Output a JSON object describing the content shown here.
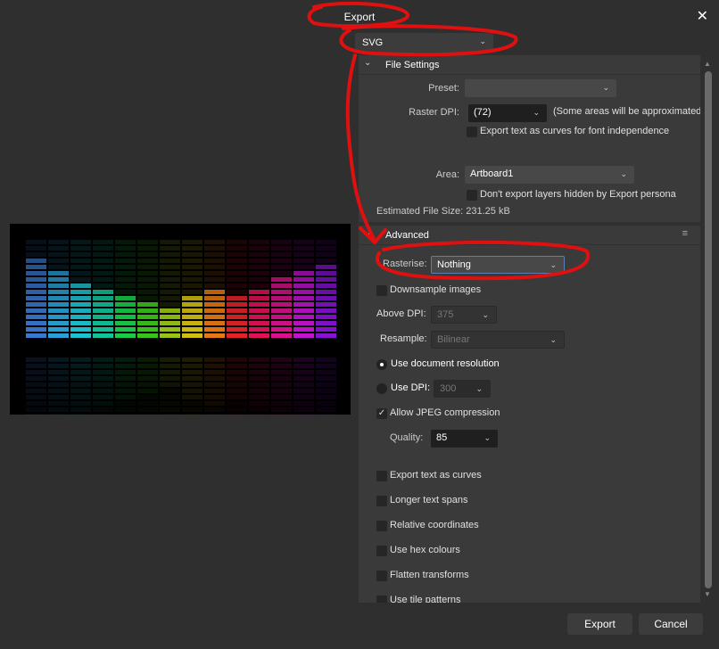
{
  "dialog": {
    "title": "Export",
    "close_icon": "close-icon"
  },
  "format": {
    "selected": "SVG"
  },
  "file_settings": {
    "header": "File Settings",
    "preset_label": "Preset:",
    "preset_value": "",
    "raster_dpi_label": "Raster DPI:",
    "raster_dpi_value": "(72)",
    "raster_dpi_note": "(Some areas will be approximated)",
    "text_curves_label": "Export text as curves for font independence",
    "text_curves_checked": false,
    "area_label": "Area:",
    "area_value": "Artboard1",
    "hidden_layers_label": "Don't export layers hidden by Export persona",
    "hidden_layers_checked": false,
    "file_size": "Estimated File Size: 231.25 kB"
  },
  "advanced": {
    "header": "Advanced",
    "rasterise_label": "Rasterise:",
    "rasterise_value": "Nothing",
    "downsample_label": "Downsample images",
    "above_dpi_label": "Above DPI:",
    "above_dpi_value": "375",
    "resample_label": "Resample:",
    "resample_value": "Bilinear",
    "use_doc_res_label": "Use document resolution",
    "use_dpi_label": "Use DPI:",
    "use_dpi_value": "300",
    "jpeg_label": "Allow JPEG compression",
    "quality_label": "Quality:",
    "quality_value": "85",
    "options": [
      {
        "label": "Export text as curves",
        "checked": false
      },
      {
        "label": "Longer text spans",
        "checked": false
      },
      {
        "label": "Relative coordinates",
        "checked": false
      },
      {
        "label": "Use hex colours",
        "checked": false
      },
      {
        "label": "Flatten transforms",
        "checked": false
      },
      {
        "label": "Use tile patterns",
        "checked": false
      }
    ]
  },
  "buttons": {
    "export": "Export",
    "cancel": "Cancel"
  },
  "colors": {
    "annotation": "#e01010",
    "accent": "#5b7fb5"
  }
}
